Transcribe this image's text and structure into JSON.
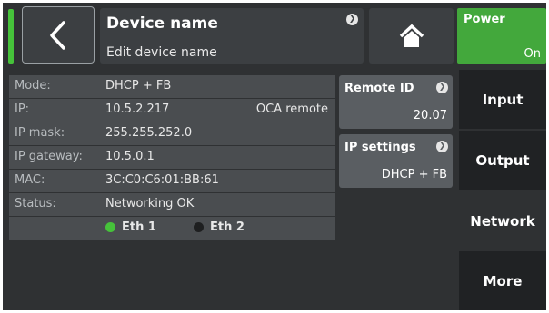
{
  "header": {
    "title": "Device name",
    "subtitle": "Edit device name",
    "power": {
      "label": "Power",
      "state": "On"
    }
  },
  "info": {
    "rows": [
      {
        "label": "Mode:",
        "value": "DHCP + FB"
      },
      {
        "label": "IP:",
        "value": "10.5.2.217",
        "extra": "OCA remote"
      },
      {
        "label": "IP mask:",
        "value": "255.255.252.0"
      },
      {
        "label": "IP gateway:",
        "value": "10.5.0.1"
      },
      {
        "label": "MAC:",
        "value": "3C:C0:C6:01:BB:61"
      },
      {
        "label": "Status:",
        "value": "Networking OK"
      }
    ],
    "eth": [
      {
        "label": "Eth 1",
        "color": "#46c23a"
      },
      {
        "label": "Eth 2",
        "color": "#1e1f20"
      }
    ]
  },
  "remote_id": {
    "label": "Remote ID",
    "value": "20.07"
  },
  "ip_settings": {
    "label": "IP settings",
    "value": "DHCP + FB"
  },
  "tabs": [
    {
      "label": "Input"
    },
    {
      "label": "Output"
    },
    {
      "label": "Network"
    },
    {
      "label": "More"
    }
  ],
  "colors": {
    "power_on": "#43a83c",
    "led": "#46c23a",
    "background": "#2f3133"
  }
}
